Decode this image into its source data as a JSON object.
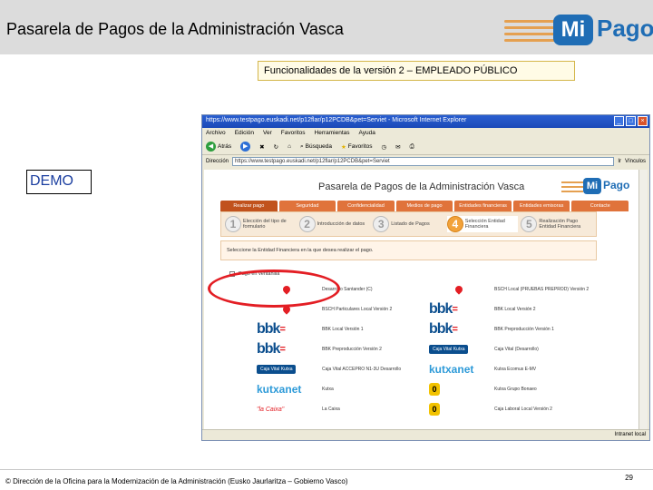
{
  "slide": {
    "title": "Pasarela de Pagos de la Administración Vasca",
    "logo_mi": "Mi",
    "logo_pago": "Pago",
    "subtitle": "Funcionalidades de la versión 2 – EMPLEADO PÚBLICO",
    "demo": "DEMO",
    "footer": "© Dirección de la Oficina para la Modernización de la Administración (Eusko Jaurlaritza – Gobierno Vasco)",
    "page_number": "29"
  },
  "browser": {
    "title": "https://www.testpago.euskadi.net/p12flar/p12PCDB&pet=Serviet - Microsoft Internet Explorer",
    "menu": [
      "Archivo",
      "Edición",
      "Ver",
      "Favoritos",
      "Herramientas",
      "Ayuda"
    ],
    "toolbar": {
      "back": "Atrás",
      "search": "Búsqueda",
      "favorites": "Favoritos"
    },
    "address_label": "Dirección",
    "address_value": "https://www.testpago.euskadi.net/p12flar/p12PCDB&pet=Serviet",
    "go_label": "Ir",
    "links_label": "Vínculos",
    "status_left": "",
    "status_right": "Intranet local"
  },
  "inner": {
    "title": "Pasarela de Pagos de la Administración Vasca",
    "logo_mi": "Mi",
    "logo_pago": "Pago",
    "tabs": [
      "Realizar pago",
      "Seguridad",
      "Confidencialidad",
      "Medios de pago",
      "Entidades financieras",
      "Entidades emisoras",
      "Contacte"
    ],
    "steps": [
      {
        "num": "1",
        "label": "Elección del tipo de formulario"
      },
      {
        "num": "2",
        "label": "Introducción de datos"
      },
      {
        "num": "3",
        "label": "Listado de Pagos"
      },
      {
        "num": "4",
        "label": "Selección Entidad Financiera"
      },
      {
        "num": "5",
        "label": "Realización Pago Entidad Financiera"
      }
    ],
    "notice": "Seleccione la Entidad Financiera en la que desea realizar el pago.",
    "option_label": "Pago en ventanilla",
    "banks": [
      {
        "left": "Desarrollo Santander (C)",
        "right": "BSCH Local (PRUEBAS PREPROD) Versión 2"
      },
      {
        "left": "BSCH Particulares Local Versión 2",
        "right": "BBK Local Versión 2"
      },
      {
        "left": "BBK Local Versión 1",
        "right": "BBK Preproducción Versión 1"
      },
      {
        "left": "BBK Preproducción Versión 2",
        "right": "Caja Vital (Desarrollo)"
      },
      {
        "left": "Caja Vital ACCEPRO N1-3U Desarrollo",
        "right": "Kutxa Ecomus E-MV"
      },
      {
        "left": "Kutxa",
        "right": "Kutxa Grupo Bonaeo"
      },
      {
        "left": "La Caixa",
        "right": "Caja Laboral Local Versión 2"
      }
    ],
    "logo_texts": {
      "bbk": "bbk",
      "bbk_mark": "=",
      "vital": "Caja Vital Kutxa",
      "kutxa": "kutxa",
      "kutxa_net": "net",
      "lacaixa": "\"la Caixa\"",
      "laboral": "0"
    }
  }
}
